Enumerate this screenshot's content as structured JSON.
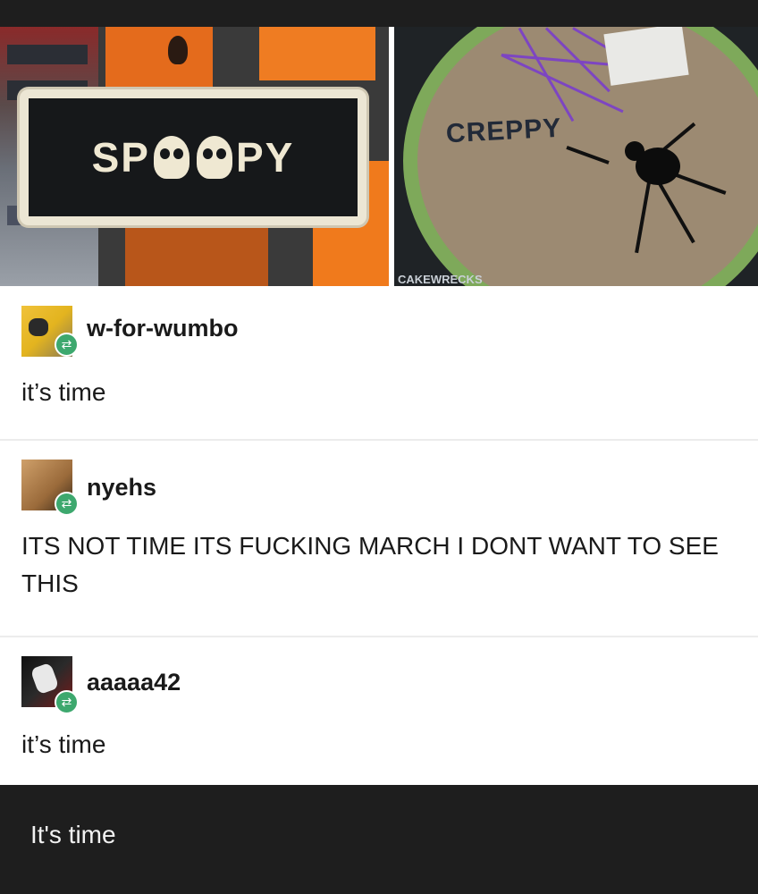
{
  "images": {
    "left": {
      "sign_text_a": "SP",
      "sign_text_b": "PY"
    },
    "right": {
      "cake_text": "CREPPY",
      "watermark": "CAKEWRECKS"
    }
  },
  "comments": [
    {
      "username": "w-for-wumbo",
      "text": "it’s time",
      "avatar_icon": "avatar-wumbo",
      "badge_icon": "reblog-icon"
    },
    {
      "username": "nyehs",
      "text": "ITS NOT TIME ITS FUCKING MARCH I DONT WANT TO SEE THIS",
      "avatar_icon": "avatar-nyehs",
      "badge_icon": "reblog-icon"
    },
    {
      "username": "aaaaa42",
      "text": "it’s time",
      "avatar_icon": "avatar-aaaaa42",
      "badge_icon": "reblog-icon"
    }
  ],
  "caption": "It's time",
  "colors": {
    "badge": "#3da86e",
    "background_dark": "#1e1e1e",
    "post_background": "#ffffff"
  }
}
